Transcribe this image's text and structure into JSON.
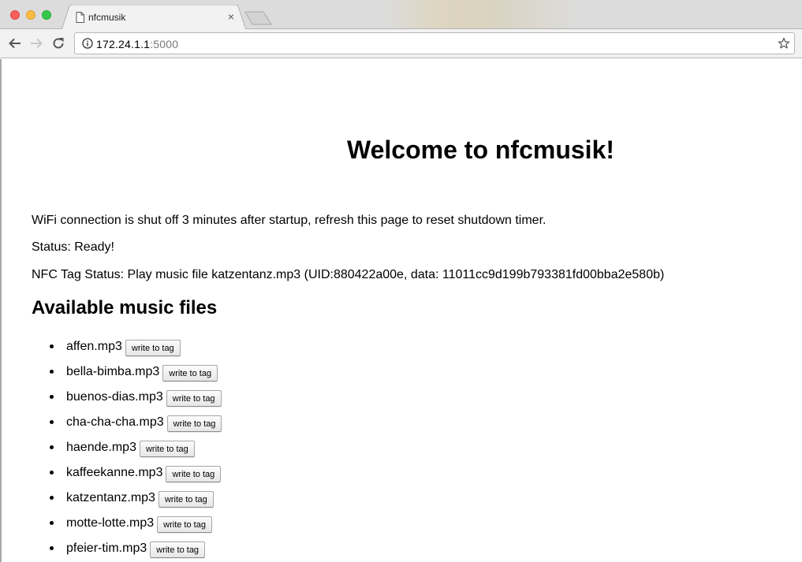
{
  "browser": {
    "tab": {
      "title": "nfcmusik",
      "icon": "page-icon",
      "close_icon": "×"
    },
    "url": {
      "host": "172.24.1.1",
      "port": ":5000"
    },
    "icons": [
      "back-icon",
      "forward-icon",
      "reload-icon",
      "info-icon",
      "star-icon"
    ]
  },
  "page": {
    "title": "Welcome to nfcmusik!",
    "wifi_notice": "WiFi connection is shut off 3 minutes after startup, refresh this page to reset shutdown timer.",
    "status": "Status: Ready!",
    "nfc_status": "NFC Tag Status: Play music file katzentanz.mp3 (UID:880422a00e, data: 11011cc9d199b793381fd00bba2e580b)",
    "section_title": "Available music files",
    "button_label": "write to tag",
    "files": [
      {
        "name": "affen.mp3"
      },
      {
        "name": "bella-bimba.mp3"
      },
      {
        "name": "buenos-dias.mp3"
      },
      {
        "name": "cha-cha-cha.mp3"
      },
      {
        "name": "haende.mp3"
      },
      {
        "name": "kaffeekanne.mp3"
      },
      {
        "name": "katzentanz.mp3"
      },
      {
        "name": "motte-lotte.mp3"
      },
      {
        "name": "pfeier-tim.mp3"
      }
    ]
  }
}
